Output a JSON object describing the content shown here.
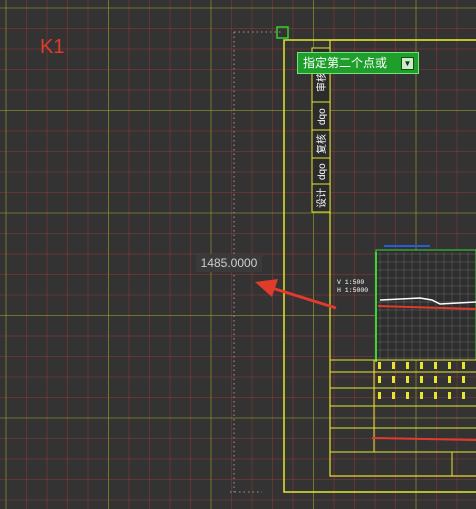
{
  "viewport": {
    "label_k1": "K1",
    "dimension_value": "1485.0000",
    "command_prompt": "指定第二个点或",
    "dropdown_icon": "down-arrow"
  },
  "title_block": {
    "cells": [
      "设计",
      "dqo",
      "复核",
      "dqo",
      "审核"
    ]
  },
  "drawing": {
    "scale_lines": [
      "V 1:500",
      "H 1:5000"
    ]
  },
  "colors": {
    "background": "#333333",
    "grid_minor": "#b83a3a",
    "grid_major": "#a3a32e",
    "frame": "#e6e62e",
    "profile_green": "#37d637",
    "arrow_red": "#e03b2b",
    "prompt_bg": "#1e9e2a"
  }
}
